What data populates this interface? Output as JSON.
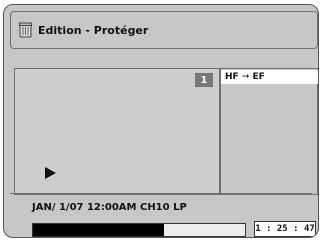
{
  "window": {
    "title": "Edition - Protéger"
  },
  "preview": {
    "index": "1"
  },
  "side_menu": {
    "item": "HF ➞ EF"
  },
  "info": {
    "text": "JAN/ 1/07 12:00AM CH10  LP"
  },
  "progress": {
    "fraction": 0.62
  },
  "timer": {
    "text": "1 : 25 : 47"
  }
}
